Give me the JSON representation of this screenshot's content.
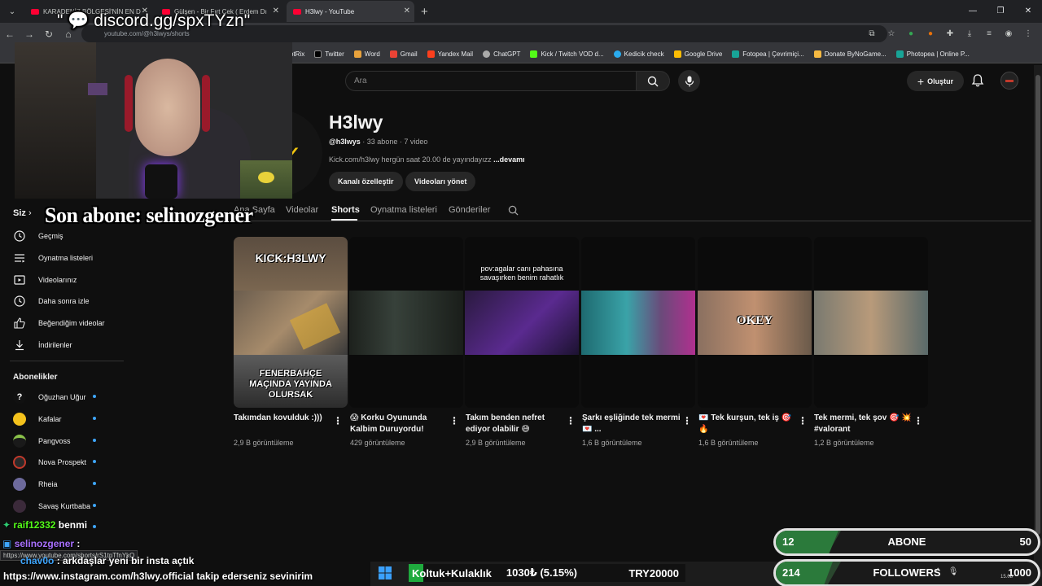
{
  "browser": {
    "tabs": [
      {
        "title": "KARADENİZ BÖLGESİ'NİN EN D"
      },
      {
        "title": "Gülşen - Bir Fırt Çek ( Erdem Dı"
      },
      {
        "title": "H3lwy - YouTube"
      }
    ],
    "url": "youtube.com/@h3lwys/shorts",
    "bookmarks": [
      "otRix",
      "Twitter",
      "Word",
      "Gmail",
      "Yandex Mail",
      "ChatGPT",
      "Kick / Twitch VOD d...",
      "Kedicik check",
      "Google Drive",
      "Fotopea | Çevrimiçi...",
      "Donate ByNoGame...",
      "Photopea | Online P..."
    ]
  },
  "youtube": {
    "search_placeholder": "Ara",
    "create_label": "Oluştur",
    "channel": {
      "name": "H3lwy",
      "handle": "@h3lwys",
      "stats": " · 33 abone · 7 video",
      "description": "Kick.com/h3lwy hergün saat 20.00 de yayındayızz ",
      "more_label": "...devamı",
      "customize_label": "Kanalı özelleştir",
      "manage_label": "Videoları yönet"
    },
    "tabs": [
      "Ana Sayfa",
      "Videolar",
      "Shorts",
      "Oynatma listeleri",
      "Gönderiler"
    ],
    "sidebar": {
      "you_label": "Siz",
      "items": [
        "Geçmiş",
        "Oynatma listeleri",
        "Videolarınız",
        "Daha sonra izle",
        "Beğendiğim videolar",
        "İndirilenler"
      ],
      "subs_heading": "Abonelikler",
      "subscriptions": [
        "Oğuzhan Uğur",
        "Kafalar",
        "Pangvoss",
        "Nova Prospekt",
        "Rheia",
        "Savaş Kurtbaba"
      ]
    },
    "shorts": [
      {
        "title": "Takımdan kovulduk :)))",
        "views": "2,9 B görüntüleme",
        "overlay_top": "KICK:H3LWY",
        "overlay_bottom": "FENERBAHÇE MAÇINDA YAYINDA OLURSAK"
      },
      {
        "title": "😱 Korku Oyununda Kalbim Duruyordu!",
        "views": "429 görüntüleme"
      },
      {
        "title": "Takım benden nefret ediyor olabilir 😅",
        "views": "2,9 B görüntüleme",
        "overlay_top": "pov:agalar canı pahasına savaşırken benim rahatlık"
      },
      {
        "title": "Şarkı eşliğinde tek mermi 💌 ...",
        "views": "1,6 B görüntüleme"
      },
      {
        "title": "💌 Tek kurşun, tek iş 🎯 🔥",
        "views": "1,6 B görüntüleme",
        "overlay_mid": "OKEY"
      },
      {
        "title": "Tek mermi, tek şov 🎯 💥 #valorant",
        "views": "1,2 B görüntüleme"
      }
    ]
  },
  "overlay": {
    "discord": "\" 💬 discord.gg/spxTYzn\"",
    "last_sub": "Son abone: selinozgener",
    "chat": [
      {
        "user": "raif12332",
        "msg": "benmi"
      },
      {
        "user": "selinozgener",
        "msg": ":"
      },
      {
        "user": "chav0o",
        "msg": ": arkdaşlar yeni bir insta açtık"
      }
    ],
    "status_url": "https://www.youtube.com/shorts/rS1tpTfnYkQ",
    "ticker": "https://www.instagram.com/h3lwy.official takip ederseniz sevinirim",
    "donation": {
      "label": "Koltuk+Kulaklık",
      "amount": "1030₺ (5.15%)",
      "target": "TRY20000",
      "progress": 0.0515
    },
    "goals": [
      {
        "current": "12",
        "label": "ABONE",
        "target": "50",
        "progress": 0.24
      },
      {
        "current": "214",
        "label": "FOLLOWERS",
        "target": "1000",
        "progress": 0.214
      }
    ],
    "tray_date": "15.08"
  },
  "colors": {
    "yt_bg": "#0f0f0f",
    "accent_red": "#ff0033",
    "goal_green": "#2b7a3b",
    "sub_dot": "#3ea6ff"
  }
}
